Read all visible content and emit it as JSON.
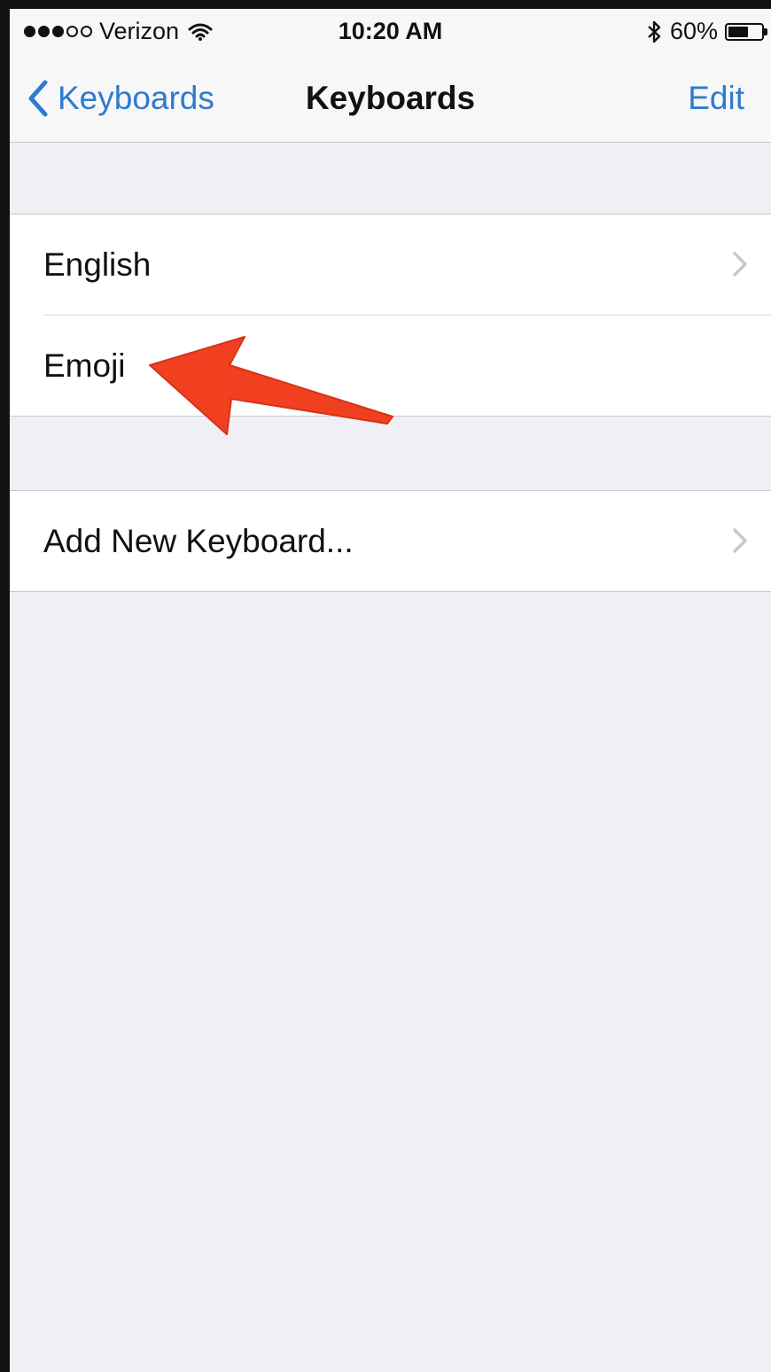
{
  "status_bar": {
    "signal_bars": [
      true,
      true,
      true,
      false,
      false
    ],
    "carrier": "Verizon",
    "time": "10:20 AM",
    "battery_percent_text": "60%",
    "battery_level": 0.6
  },
  "nav_bar": {
    "back_label": "Keyboards",
    "title": "Keyboards",
    "edit_label": "Edit"
  },
  "keyboards": [
    {
      "label": "English"
    },
    {
      "label": "Emoji"
    }
  ],
  "add_keyboard": {
    "label": "Add New Keyboard..."
  },
  "colors": {
    "accent": "#2e7ad1",
    "background": "#efeff4",
    "annotation_arrow": "#f0401f"
  },
  "icons": [
    "wifi-icon",
    "bluetooth-icon",
    "battery-icon",
    "back-chevron-icon",
    "chevron-right-icon",
    "annotation-arrow"
  ]
}
